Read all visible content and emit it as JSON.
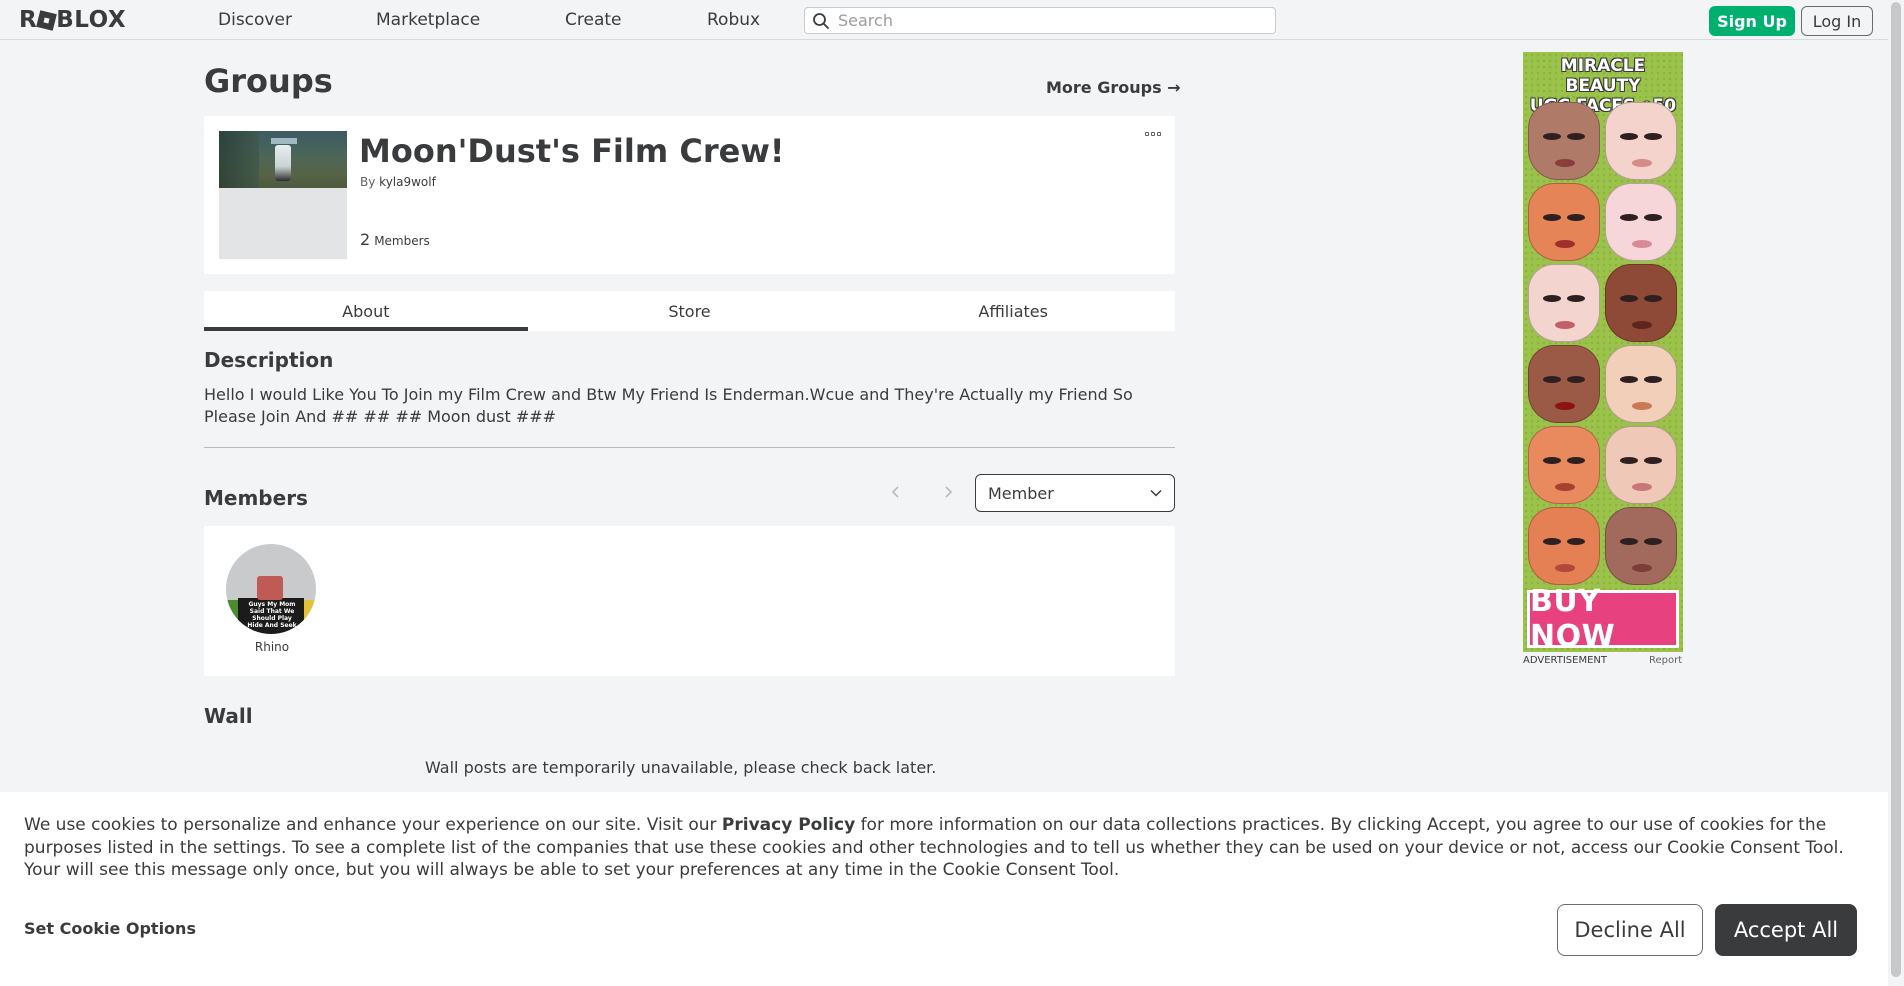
{
  "header": {
    "logo_text": "ROBLOX",
    "nav": [
      "Discover",
      "Marketplace",
      "Create",
      "Robux"
    ],
    "search_placeholder": "Search",
    "signup_label": "Sign Up",
    "login_label": "Log In"
  },
  "page": {
    "title": "Groups",
    "more_groups": "More Groups →"
  },
  "group": {
    "name": "Moon'Dust's Film Crew!",
    "by_prefix": "By",
    "owner": "kyla9wolf",
    "member_count": "2",
    "member_label": "Members"
  },
  "tabs": [
    {
      "label": "About",
      "active": true
    },
    {
      "label": "Store",
      "active": false
    },
    {
      "label": "Affiliates",
      "active": false
    }
  ],
  "description": {
    "heading": "Description",
    "text": "Hello I would Like You To Join my Film Crew and Btw My Friend Is Enderman.Wcue and They're Actually my Friend So Please Join And ## ## ## Moon dust ###"
  },
  "members": {
    "heading": "Members",
    "role_selected": "Member",
    "list": [
      {
        "name": "Rhino",
        "shirt_text": "Guys My Mom Said That We Should Play Hide And Seek"
      }
    ]
  },
  "wall": {
    "heading": "Wall",
    "message": "Wall posts are temporarily unavailable, please check back later."
  },
  "ad": {
    "title_line1": "MIRACLE BEAUTY",
    "title_line2": "UGC FACES",
    "price": "50",
    "cta": "BUY NOW",
    "label": "ADVERTISEMENT",
    "report": "Report",
    "accent_color": "#e8417f",
    "background_color": "#9bc24a"
  },
  "cookie": {
    "text_before_link": "We use cookies to personalize and enhance your experience on our site. Visit our ",
    "link": "Privacy Policy",
    "text_after_link": " for more information on our data collections practices. By clicking Accept, you agree to our use of cookies for the purposes listed in the settings. To see a complete list of the companies that use these cookies and other technologies and to tell us whether they can be used on your device or not, access our Cookie Consent Tool. Your will see this message only once, but you will always be able to set your preferences at any time in the Cookie Consent Tool.",
    "options_label": "Set Cookie Options",
    "decline_label": "Decline All",
    "accept_label": "Accept All"
  },
  "colors": {
    "signup_green": "#00b06f",
    "text_dark": "#393b3d",
    "page_bg": "#f2f4f5"
  }
}
